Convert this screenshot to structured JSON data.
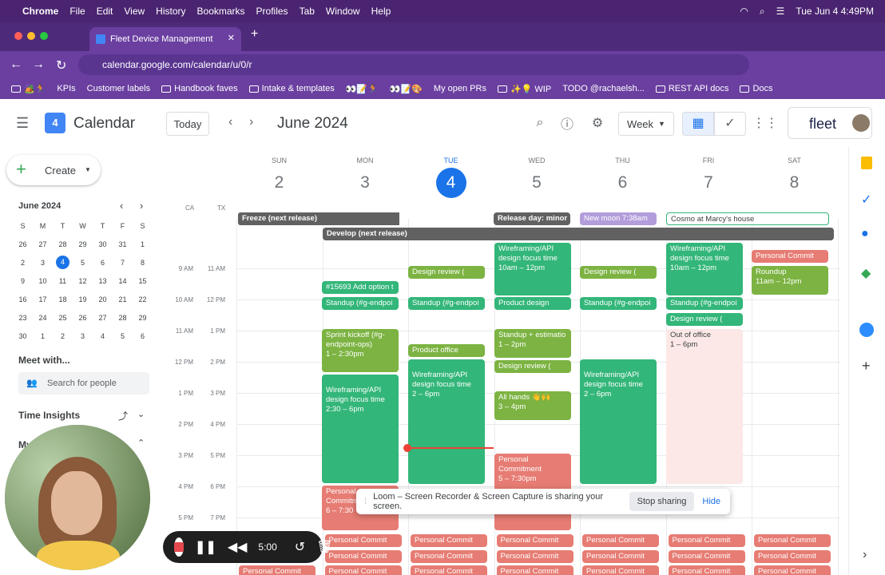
{
  "menubar": {
    "apple": "",
    "app": "Chrome",
    "items": [
      "File",
      "Edit",
      "View",
      "History",
      "Bookmarks",
      "Profiles",
      "Tab",
      "Window",
      "Help"
    ],
    "datetime": "Tue Jun 4  4:49PM"
  },
  "tab": {
    "title": "Fleet Device Management"
  },
  "omnibox": {
    "url": "calendar.google.com/calendar/u/0/r"
  },
  "bookmarks": [
    "🏕️🏃",
    "KPIs",
    "Customer labels",
    "Handbook faves",
    "Intake & templates",
    "👀📝🏃",
    "👀📝🎨",
    "My open PRs",
    "✨💡 WIP",
    "TODO @rachaelsh...",
    "REST API docs",
    "Docs"
  ],
  "header": {
    "app_name": "Calendar",
    "today_label": "Today",
    "month_label": "June 2024",
    "view_label": "Week",
    "brand": "fleet"
  },
  "sidebar": {
    "create_label": "Create",
    "mini_month": "June 2024",
    "dow": [
      "S",
      "M",
      "T",
      "W",
      "T",
      "F",
      "S"
    ],
    "weeks": [
      [
        "26",
        "27",
        "28",
        "29",
        "30",
        "31",
        "1"
      ],
      [
        "2",
        "3",
        "4",
        "5",
        "6",
        "7",
        "8"
      ],
      [
        "9",
        "10",
        "11",
        "12",
        "13",
        "14",
        "15"
      ],
      [
        "16",
        "17",
        "18",
        "19",
        "20",
        "21",
        "22"
      ],
      [
        "23",
        "24",
        "25",
        "26",
        "27",
        "28",
        "29"
      ],
      [
        "30",
        "1",
        "2",
        "3",
        "4",
        "5",
        "6"
      ]
    ],
    "meet_with": "Meet with...",
    "search_people": "Search for people",
    "time_insights": "Time Insights",
    "my_calendars": "My"
  },
  "grid": {
    "tz": [
      "CA",
      "TX"
    ],
    "days": [
      {
        "dow": "SUN",
        "num": "2"
      },
      {
        "dow": "MON",
        "num": "3"
      },
      {
        "dow": "TUE",
        "num": "4"
      },
      {
        "dow": "WED",
        "num": "5"
      },
      {
        "dow": "THU",
        "num": "6"
      },
      {
        "dow": "FRI",
        "num": "7"
      },
      {
        "dow": "SAT",
        "num": "8"
      }
    ],
    "times_ca": [
      "9 AM",
      "10 AM",
      "11 AM",
      "12 PM",
      "1 PM",
      "2 PM",
      "3 PM",
      "4 PM",
      "5 PM"
    ],
    "times_tx": [
      "11 AM",
      "12 PM",
      "1 PM",
      "2 PM",
      "3 PM",
      "4 PM",
      "5 PM",
      "6 PM",
      "7 PM"
    ],
    "allday": {
      "freeze": "Freeze (next release)",
      "develop": "Develop (next release)",
      "release": "Release day: minor",
      "moon": "New moon 7:38am",
      "cosmo": "Cosmo at Marcy's house"
    },
    "events": {
      "mon_option": "#15693 Add option t",
      "mon_standup": "Standup (#g-endpoi",
      "mon_sprint": "Sprint kickoff (#g-endpoint-ops)",
      "mon_sprint_time": "1 – 2:30pm",
      "mon_wire": "Wireframing/API design focus time",
      "mon_wire_time": "2:30 – 6pm",
      "mon_personal": "Personal Commitment",
      "mon_personal_time": "6 – 7:30",
      "tue_design": "Design review (",
      "tue_standup": "Standup (#g-endpoi",
      "tue_product": "Product office",
      "tue_wire": "Wireframing/API design focus time",
      "tue_wire_time": "2 – 6pm",
      "wed_wire": "Wireframing/API design focus time",
      "wed_wire_time": "10am – 12pm",
      "wed_product": "Product design",
      "wed_standup": "Standup + estimatio",
      "wed_standup_time": "1 – 2pm",
      "wed_design": "Design review (",
      "wed_allhands": "All hands 👋🙌",
      "wed_allhands_time": "3 – 4pm",
      "wed_personal": "Personal Commitment",
      "wed_personal_time": "5 – 7:30pm",
      "thu_design": "Design review (",
      "thu_standup": "Standup (#g-endpoi",
      "thu_wire": "Wireframing/API design focus time",
      "thu_wire_time": "2 – 6pm",
      "fri_wire": "Wireframing/API design focus time",
      "fri_wire_time": "10am – 12pm",
      "fri_standup": "Standup (#g-endpoi",
      "fri_design": "Design review (",
      "fri_ooo": "Out of office",
      "fri_ooo_time": "1 – 6pm",
      "sat_personal": "Personal Commit",
      "sat_roundup": "Roundup",
      "sat_roundup_time": "11am – 12pm",
      "personal_short": "Personal Commit"
    }
  },
  "loom": {
    "message": "Loom – Screen Recorder & Screen Capture is sharing your screen.",
    "stop": "Stop sharing",
    "hide": "Hide"
  },
  "recorder": {
    "timer": "5:00"
  }
}
